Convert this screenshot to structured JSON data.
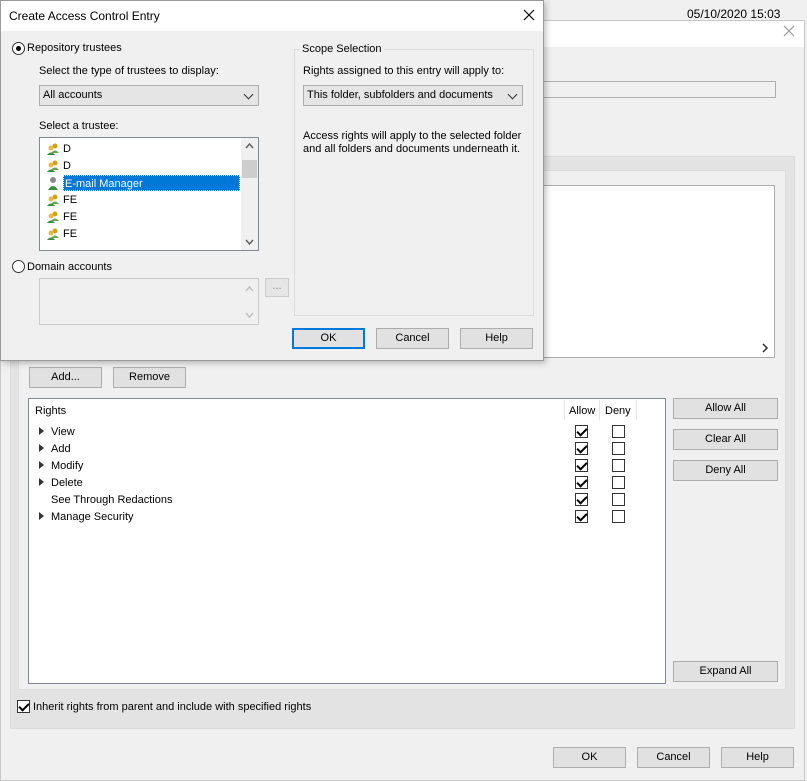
{
  "background": {
    "timestamp": "05/10/2020 15:03",
    "buttons": {
      "add": "Add...",
      "remove": "Remove",
      "allow_all": "Allow All",
      "clear_all": "Clear All",
      "deny_all": "Deny All",
      "expand_all": "Expand All",
      "ok": "OK",
      "cancel": "Cancel",
      "help": "Help"
    },
    "rights_table": {
      "headers": {
        "rights": "Rights",
        "allow": "Allow",
        "deny": "Deny"
      },
      "rows": [
        {
          "label": "View",
          "expandable": true,
          "allow": true,
          "deny": false
        },
        {
          "label": "Add",
          "expandable": true,
          "allow": true,
          "deny": false
        },
        {
          "label": "Modify",
          "expandable": true,
          "allow": true,
          "deny": false
        },
        {
          "label": "Delete",
          "expandable": true,
          "allow": true,
          "deny": false
        },
        {
          "label": "See Through Redactions",
          "expandable": false,
          "allow": true,
          "deny": false
        },
        {
          "label": "Manage Security",
          "expandable": true,
          "allow": true,
          "deny": false
        }
      ]
    },
    "inherit_label": "Inherit rights from parent and include with specified rights",
    "inherit_checked": true
  },
  "dialog": {
    "title": "Create Access Control Entry",
    "repository_trustees_label": "Repository trustees",
    "repository_trustees_selected": true,
    "type_label": "Select the type of trustees to display:",
    "type_value": "All accounts",
    "trustee_label": "Select a trustee:",
    "trustees": [
      {
        "name": "D",
        "icon": "group-icon",
        "selected": false
      },
      {
        "name": "D",
        "icon": "group-icon",
        "selected": false
      },
      {
        "name": "E-mail Manager",
        "icon": "user-icon",
        "selected": true
      },
      {
        "name": "FE",
        "icon": "group-icon",
        "selected": false
      },
      {
        "name": "FE",
        "icon": "group-icon",
        "selected": false
      },
      {
        "name": "FE",
        "icon": "group-icon",
        "selected": false
      }
    ],
    "domain_accounts_label": "Domain accounts",
    "browse_label": "...",
    "scope": {
      "legend": "Scope Selection",
      "applies_label": "Rights assigned to this entry will apply to:",
      "applies_value": "This folder, subfolders and documents",
      "description": "Access rights will apply to the selected folder and all folders and documents underneath it."
    },
    "buttons": {
      "ok": "OK",
      "cancel": "Cancel",
      "help": "Help"
    }
  },
  "colors": {
    "accent": "#0078d7",
    "selection": "#0078d7"
  }
}
